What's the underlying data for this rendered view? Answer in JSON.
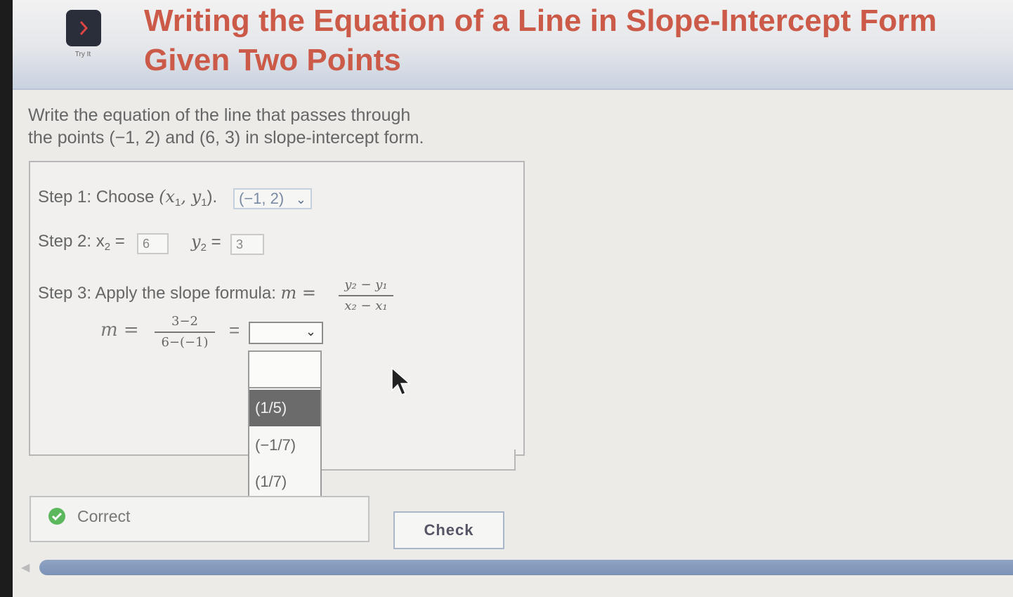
{
  "header": {
    "title_line1": "Writing the Equation of a Line in Slope-Intercept Form",
    "title_line2": "Given Two Points",
    "app_icon_label": "Try It"
  },
  "prompt": {
    "line1": "Write the equation of the line that passes through",
    "line2": "the points (−1, 2) and (6, 3) in slope-intercept form."
  },
  "step1": {
    "label": "Step 1: Choose ",
    "var_open": "(x",
    "sub1": "1",
    "var_mid": ", y",
    "sub2": "1",
    "var_close": ").",
    "selected": "(−1, 2)"
  },
  "step2": {
    "label": "Step 2: x",
    "x_sub": "2",
    "eq": " =",
    "x_value": "6",
    "y_label": "y",
    "y_sub": "2",
    "y_eq": " =",
    "y_value": "3"
  },
  "step3": {
    "label": "Step 3: Apply the slope formula: ",
    "m_eq": "m =",
    "formula_num": "y₂ − y₁",
    "formula_den": "x₂ − x₁",
    "m_eq2": "m =",
    "calc_num": "3−2",
    "calc_den": "6−(−1)",
    "eq": "=",
    "selected": ""
  },
  "dropdown": {
    "options": [
      "",
      "(1/5)",
      "(−1/7)",
      "(1/7)"
    ],
    "highlighted_index": 1
  },
  "feedback": {
    "text": "Correct",
    "status_color": "#5cb85c"
  },
  "actions": {
    "check_label": "Check"
  },
  "colors": {
    "title": "#cc5a48",
    "accent": "#7b92b7"
  }
}
